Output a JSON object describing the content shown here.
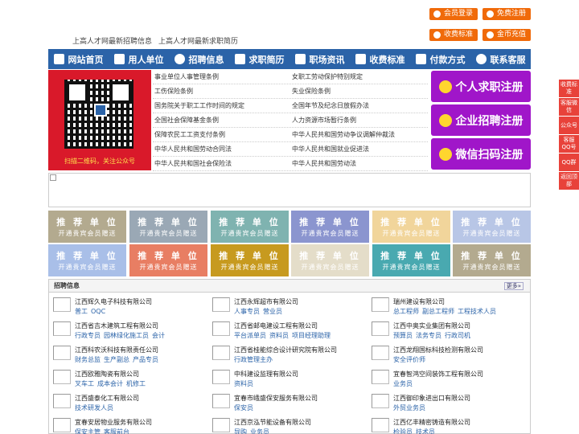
{
  "top_buttons": [
    {
      "label": "会员登录"
    },
    {
      "label": "免费注册"
    },
    {
      "label": "收费标准"
    },
    {
      "label": "金币充值"
    }
  ],
  "subtitle": [
    "上高人才网最新招聘信息",
    "上高人才网最新求职简历"
  ],
  "nav": [
    {
      "label": "网站首页",
      "icon": "home-icon"
    },
    {
      "label": "用人单位",
      "icon": "building-icon"
    },
    {
      "label": "招聘信息",
      "icon": "recruit-icon"
    },
    {
      "label": "求职简历",
      "icon": "resume-icon"
    },
    {
      "label": "职场资讯",
      "icon": "news-icon"
    },
    {
      "label": "收费标准",
      "icon": "fee-icon"
    },
    {
      "label": "付款方式",
      "icon": "payment-icon"
    },
    {
      "label": "联系客服",
      "icon": "phone-icon"
    }
  ],
  "qr_caption": "扫描二维码，关注公众号",
  "policy_links": [
    [
      "事业单位人事管理条例",
      "女职工劳动保护特别规定"
    ],
    [
      "工伤保险条例",
      "失业保险条例"
    ],
    [
      "国务院关于职工工作时间的规定",
      "全国年节及纪念日放假办法"
    ],
    [
      "全国社会保障基金条例",
      "人力资源市场暂行条例"
    ],
    [
      "保障农民工工资支付条例",
      "中华人民共和国劳动争议调解仲裁法"
    ],
    [
      "中华人民共和国劳动合同法",
      "中华人民共和国就业促进法"
    ],
    [
      "中华人民共和国社会保险法",
      "中华人民共和国劳动法"
    ]
  ],
  "register_buttons": [
    {
      "label": "个人求职注册"
    },
    {
      "label": "企业招聘注册"
    },
    {
      "label": "微信扫码注册"
    }
  ],
  "ad_slots": [
    {
      "title": "推 荐 单 位",
      "sub": "开通贵宾会员赠送",
      "color": "#b3aa8f"
    },
    {
      "title": "推 荐 单 位",
      "sub": "开通贵宾会员赠送",
      "color": "#9aa8b5"
    },
    {
      "title": "推 荐 单 位",
      "sub": "开通贵宾会员赠送",
      "color": "#7fb3b0"
    },
    {
      "title": "推 荐 单 位",
      "sub": "开通贵宾会员赠送",
      "color": "#8b95cf"
    },
    {
      "title": "推 荐 单 位",
      "sub": "开通贵宾会员赠送",
      "color": "#f1d59b"
    },
    {
      "title": "推 荐 单 位",
      "sub": "开通贵宾会员赠送",
      "color": "#b8c6e6"
    },
    {
      "title": "推 荐 单 位",
      "sub": "开通贵宾会员赠送",
      "color": "#a9bfe8"
    },
    {
      "title": "推 荐 单 位",
      "sub": "开通贵宾会员赠送",
      "color": "#e87e63"
    },
    {
      "title": "推 荐 单 位",
      "sub": "开通贵宾会员赠送",
      "color": "#c79a1f"
    },
    {
      "title": "推 荐 单 位",
      "sub": "开通贵宾会员赠送",
      "color": "#e4ddc9"
    },
    {
      "title": "推 荐 单 位",
      "sub": "开通贵宾会员赠送",
      "color": "#49a9b0"
    },
    {
      "title": "推 荐 单 位",
      "sub": "开通贵宾会员赠送",
      "color": "#b3aa8f"
    }
  ],
  "jobs_section": {
    "title": "招聘信息",
    "more": "更多»"
  },
  "jobs": [
    [
      {
        "company": "江西辉久电子科技有限公司",
        "positions": [
          "普工",
          "OQC"
        ]
      },
      {
        "company": "江西省吉木建筑工程有限公司",
        "positions": [
          "行政专员",
          "园林绿化施工员",
          "会计"
        ]
      },
      {
        "company": "江西科农沃科技有限责任公司",
        "positions": [
          "财务总监",
          "生产副总",
          "产品专员"
        ]
      },
      {
        "company": "江西欧雅陶瓷有限公司",
        "positions": [
          "叉车工",
          "成本会计",
          "机修工"
        ]
      },
      {
        "company": "江西盛泰化工有限公司",
        "positions": [
          "技术研发人员"
        ]
      },
      {
        "company": "宜春安居物业服务有限公司",
        "positions": [
          "保安主管",
          "客服前台"
        ]
      }
    ],
    [
      {
        "company": "江西永辉超市有限公司",
        "positions": [
          "人事专员",
          "营业员"
        ]
      },
      {
        "company": "江西省邮电建设工程有限公司",
        "positions": [
          "平台派单员",
          "资料员",
          "项目经理助理"
        ]
      },
      {
        "company": "江西省桂能综合设计研究院有限公司",
        "positions": [
          "行政管理主办"
        ]
      },
      {
        "company": "中科建设监理有限公司",
        "positions": [
          "资料员"
        ]
      },
      {
        "company": "宜春市峨盛保安服务有限公司",
        "positions": [
          "保安员"
        ]
      },
      {
        "company": "江西京泓节能设备有限公司",
        "positions": [
          "导购",
          "业务员"
        ]
      }
    ],
    [
      {
        "company": "瑞州建设有限公司",
        "positions": [
          "总工程师",
          "副总工程师",
          "工程技术人员"
        ]
      },
      {
        "company": "江西中奥实业集团有限公司",
        "positions": [
          "预算员",
          "法务专员",
          "行政司机"
        ]
      },
      {
        "company": "江西龙翔国标科技检测有限公司",
        "positions": [
          "安全评价师"
        ]
      },
      {
        "company": "宜春智鸿空间装饰工程有限公司",
        "positions": [
          "业务员"
        ]
      },
      {
        "company": "江西御印象进出口有限公司",
        "positions": [
          "外贸业务员"
        ]
      },
      {
        "company": "江西亿丰精密铸造有限公司",
        "positions": [
          "检验员",
          "技术员"
        ]
      }
    ]
  ],
  "side_buttons": [
    {
      "label": "收费标准"
    },
    {
      "label": "客服微信"
    },
    {
      "label": "公众号"
    },
    {
      "label": "客服QQ号"
    },
    {
      "label": "QQ群"
    },
    {
      "label": "返回顶部"
    }
  ],
  "colors": {
    "nav": "#2b63a8",
    "orange": "#f06a0a",
    "purple": "#a016c9",
    "red": "#d9192a",
    "side": "#e8423a"
  }
}
